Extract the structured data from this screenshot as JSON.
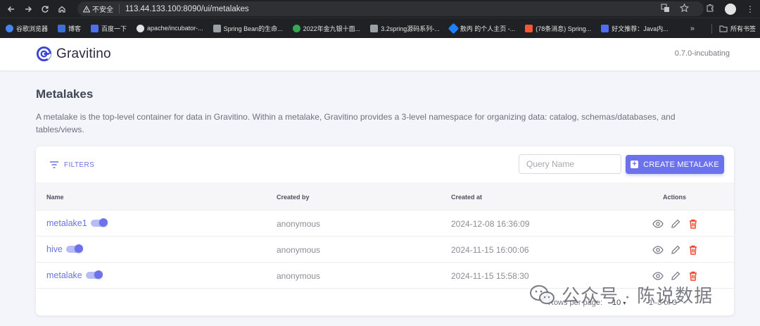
{
  "browser": {
    "insecure_label": "不安全",
    "url": "113.44.133.100:8090/ui/metalakes",
    "bookmarks": [
      {
        "label": "谷歌浏览器",
        "color": "#4285f4"
      },
      {
        "label": "博客",
        "color": "#3a6fd8"
      },
      {
        "label": "百度一下",
        "color": "#4e6ef2"
      },
      {
        "label": "apache/incubator-...",
        "color": "#e3e3e3"
      },
      {
        "label": "Spring Bean的生命...",
        "color": "#9aa0a6"
      },
      {
        "label": "2022年金九银十面...",
        "color": "#34a853"
      },
      {
        "label": "3.2spring源码系列-...",
        "color": "#9aa0a6"
      },
      {
        "label": "敖丙 的个人主页 -...",
        "color": "#1e80ff"
      },
      {
        "label": "(78条消息) Spring...",
        "color": "#fc5531"
      },
      {
        "label": "好文推荐：Java内...",
        "color": "#4e6ef2"
      }
    ],
    "all_bookmarks": "所有书签"
  },
  "app": {
    "name": "Gravitino",
    "version": "0.7.0-incubating",
    "brand_color": "#6b72ec"
  },
  "page": {
    "title": "Metalakes",
    "description": "A metalake is the top-level container for data in Gravitino. Within a metalake, Gravitino provides a 3-level namespace for organizing data: catalog, schemas/databases, and tables/views."
  },
  "toolbar": {
    "filters_label": "FILTERS",
    "search_placeholder": "Query Name",
    "create_label": "CREATE METALAKE"
  },
  "table": {
    "headers": {
      "name": "Name",
      "created_by": "Created by",
      "created_at": "Created at",
      "actions": "Actions"
    },
    "rows": [
      {
        "name": "metalake1",
        "created_by": "anonymous",
        "created_at": "2024-12-08 16:36:09",
        "enabled": true
      },
      {
        "name": "hive",
        "created_by": "anonymous",
        "created_at": "2024-11-15 16:00:06",
        "enabled": true
      },
      {
        "name": "metalake",
        "created_by": "anonymous",
        "created_at": "2024-11-15 15:58:30",
        "enabled": true
      }
    ]
  },
  "pagination": {
    "rows_per_page_label": "Rows per page:",
    "rows_per_page": "10",
    "range": "1–3 of 3"
  },
  "watermark": {
    "text": "公众号 · 陈说数据"
  }
}
